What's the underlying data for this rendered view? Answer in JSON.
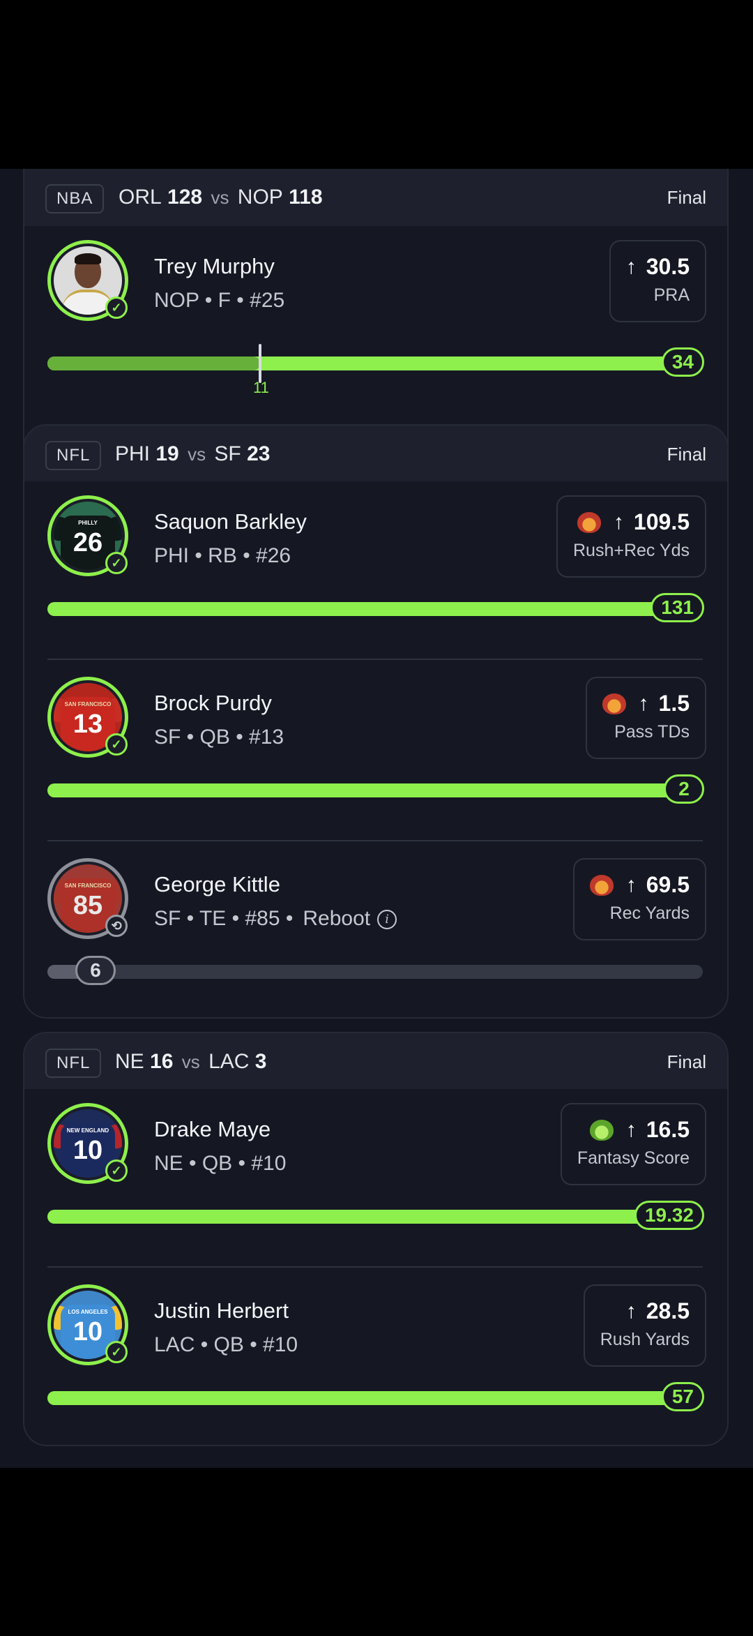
{
  "colors": {
    "accent": "#8ef04c",
    "background": "#131520",
    "card": "#151823"
  },
  "games": [
    {
      "league": "NBA",
      "team1": "ORL",
      "score1": "128",
      "vs": "vs",
      "team2": "NOP",
      "score2": "118",
      "status": "Final",
      "players": [
        {
          "name": "Trey Murphy",
          "meta": "NOP • F • #25",
          "direction": "arrow-up-icon",
          "line": "30.5",
          "stat": "PRA",
          "result": "34",
          "progress": 1.0,
          "marker_label": "11",
          "marker_progress": 0.34,
          "status_icon": "check-icon"
        }
      ]
    },
    {
      "league": "NFL",
      "team1": "PHI",
      "score1": "19",
      "vs": "vs",
      "team2": "SF",
      "score2": "23",
      "status": "Final",
      "players": [
        {
          "name": "Saquon Barkley",
          "meta": "PHI • RB • #26",
          "badge": "demon-icon",
          "line": "109.5",
          "stat": "Rush+Rec Yds",
          "result": "131",
          "progress": 1.0,
          "jersey_number": "26",
          "jersey_text": "PHILLY",
          "status_icon": "check-icon"
        },
        {
          "name": "Brock Purdy",
          "meta": "SF • QB • #13",
          "badge": "demon-icon",
          "line": "1.5",
          "stat": "Pass TDs",
          "result": "2",
          "progress": 1.0,
          "jersey_number": "13",
          "jersey_text": "SAN FRANCISCO",
          "status_icon": "check-icon"
        },
        {
          "name": "George Kittle",
          "meta": "SF • TE • #85 •",
          "extra": "Reboot",
          "badge": "demon-icon",
          "line": "69.5",
          "stat": "Rec Yards",
          "result": "6",
          "progress": 0.09,
          "jersey_number": "85",
          "jersey_text": "SAN FRANCISCO",
          "status_icon": "reboot-icon"
        }
      ]
    },
    {
      "league": "NFL",
      "team1": "NE",
      "score1": "16",
      "vs": "vs",
      "team2": "LAC",
      "score2": "3",
      "status": "Final",
      "players": [
        {
          "name": "Drake Maye",
          "meta": "NE • QB • #10",
          "badge": "goblin-icon",
          "line": "16.5",
          "stat": "Fantasy Score",
          "result": "19.32",
          "progress": 1.0,
          "jersey_number": "10",
          "jersey_text": "NEW ENGLAND",
          "status_icon": "check-icon"
        },
        {
          "name": "Justin Herbert",
          "meta": "LAC • QB • #10",
          "line": "28.5",
          "stat": "Rush Yards",
          "result": "57",
          "progress": 1.0,
          "jersey_number": "10",
          "jersey_text": "LOS ANGELES",
          "status_icon": "check-icon"
        }
      ]
    }
  ]
}
